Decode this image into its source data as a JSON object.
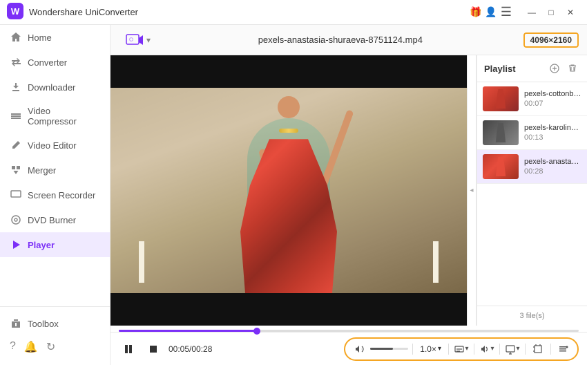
{
  "titleBar": {
    "appName": "Wondershare UniConverter",
    "icons": [
      "gift-icon",
      "user-icon",
      "menu-icon"
    ]
  },
  "sidebar": {
    "items": [
      {
        "id": "home",
        "label": "Home",
        "icon": "home-icon",
        "active": false
      },
      {
        "id": "converter",
        "label": "Converter",
        "icon": "converter-icon",
        "active": false
      },
      {
        "id": "downloader",
        "label": "Downloader",
        "icon": "download-icon",
        "active": false
      },
      {
        "id": "video-compressor",
        "label": "Video Compressor",
        "icon": "compress-icon",
        "active": false
      },
      {
        "id": "video-editor",
        "label": "Video Editor",
        "icon": "edit-icon",
        "active": false
      },
      {
        "id": "merger",
        "label": "Merger",
        "icon": "merge-icon",
        "active": false
      },
      {
        "id": "screen-recorder",
        "label": "Screen Recorder",
        "icon": "screen-icon",
        "active": false
      },
      {
        "id": "dvd-burner",
        "label": "DVD Burner",
        "icon": "dvd-icon",
        "active": false
      },
      {
        "id": "player",
        "label": "Player",
        "icon": "player-icon",
        "active": true
      }
    ],
    "bottomItems": [
      {
        "id": "toolbox",
        "label": "Toolbox",
        "icon": "toolbox-icon",
        "active": false
      }
    ],
    "footerIcons": [
      "help-icon",
      "bell-icon",
      "refresh-icon"
    ]
  },
  "playerTopBar": {
    "addFileLabel": "＋",
    "fileName": "pexels-anastasia-shuraeva-8751124.mp4",
    "resolution": "4096×2160"
  },
  "playlist": {
    "title": "Playlist",
    "fileCount": "3 file(s)",
    "items": [
      {
        "id": "item1",
        "name": "pexels-cottonbr...",
        "duration": "00:07",
        "thumbClass": "thumb-1",
        "active": false
      },
      {
        "id": "item2",
        "name": "pexels-karolina-...",
        "duration": "00:13",
        "thumbClass": "thumb-2",
        "active": false
      },
      {
        "id": "item3",
        "name": "pexels-anastasia...",
        "duration": "00:28",
        "thumbClass": "thumb-3",
        "active": true
      }
    ]
  },
  "playerControls": {
    "pauseIcon": "⏸",
    "stopIcon": "■",
    "currentTime": "00:05/00:28",
    "speed": "1.0×",
    "speedChevron": "▾",
    "textIcon": "T↕",
    "audioIcon": "⊞",
    "screenIcon": "⊡",
    "cropIcon": "⊡",
    "menuIcon": "≡"
  },
  "windowControls": {
    "minimize": "—",
    "maximize": "□",
    "close": "✕"
  }
}
